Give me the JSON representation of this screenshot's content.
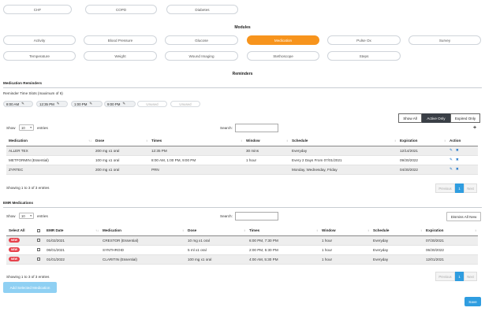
{
  "conditions": [
    "CHF",
    "COPD",
    "Diabetes"
  ],
  "modules_title": "Modules",
  "modules_row1": [
    "Activity",
    "Blood Pressure",
    "Glucose",
    "Medication",
    "Pulse Ox",
    "Survey"
  ],
  "modules_row2": [
    "Temperature",
    "Weight",
    "Wound Imaging",
    "Stethoscope",
    "Steps"
  ],
  "active_module": "Medication",
  "reminders_title": "Reminders",
  "med_reminders": {
    "section_label": "Medication Reminders",
    "slots_label": "Reminder Time Slots (maximum of 6)",
    "slots": [
      "8:00 AM",
      "12:35 PM",
      "1:00 PM",
      "9:00 PM"
    ],
    "unused": [
      "Unused",
      "Unused"
    ],
    "filters": [
      "Show All",
      "Active Only",
      "Expired Only"
    ],
    "active_filter": "Active Only",
    "add_icon": "+",
    "show": "Show",
    "entries_value": "10",
    "entries": "entries",
    "search": "Search:",
    "columns": [
      "Medication",
      "Dose",
      "Times",
      "Window",
      "Schedule",
      "Expiration",
      "Action"
    ],
    "rows": [
      [
        "ALLER TEX",
        "200 mg x1 oral",
        "12:35 PM",
        "30 mins",
        "Everyday",
        "12/14/2021"
      ],
      [
        "METFORMIN (Essential)",
        "100 mg x1 oral",
        "8:00 AM, 1:00 PM, 9:00 PM",
        "1 hour",
        "Every 2 Days From 07/01/2021",
        "09/30/2022"
      ],
      [
        "ZYRTEC",
        "200 mg x1 oral",
        "PRN",
        "",
        "Monday, Wednesday, Friday",
        "04/30/2022"
      ]
    ],
    "showing": "Showing 1 to 3 of 3 entries",
    "prev": "Previous",
    "page": "1",
    "next": "Next"
  },
  "emr": {
    "section_label": "EMR Medications",
    "show": "Show",
    "entries_value": "10",
    "entries": "entries",
    "search": "Search:",
    "dismiss": "Dismiss All New",
    "columns": [
      "Select All",
      "",
      "EMR Date",
      "Medication",
      "Dose",
      "Times",
      "Window",
      "Schedule",
      "Expiration"
    ],
    "badge": "NEW",
    "rows": [
      [
        "01/02/2021",
        "CRESTOR (Essential)",
        "10 mg x1 oral",
        "6:00 PM, 7:30 PM",
        "1 hour",
        "Everyday",
        "07/30/2021"
      ],
      [
        "06/01/2021",
        "SYNTHROID",
        "5 ml x1 oral",
        "2:00 PM, 5:30 PM",
        "1 hour",
        "Everyday",
        "06/30/2022"
      ],
      [
        "01/01/2022",
        "CLARITIN (Essential)",
        "100 mg x1 oral",
        "4:00 AM, 5:30 PM",
        "1 hour",
        "Everyday",
        "12/01/2021"
      ]
    ],
    "showing": "Showing 1 to 3 of 3 entries",
    "prev": "Previous",
    "page": "1",
    "next": "Next",
    "add_selected": "Add Selected Medication"
  },
  "save": "Save"
}
